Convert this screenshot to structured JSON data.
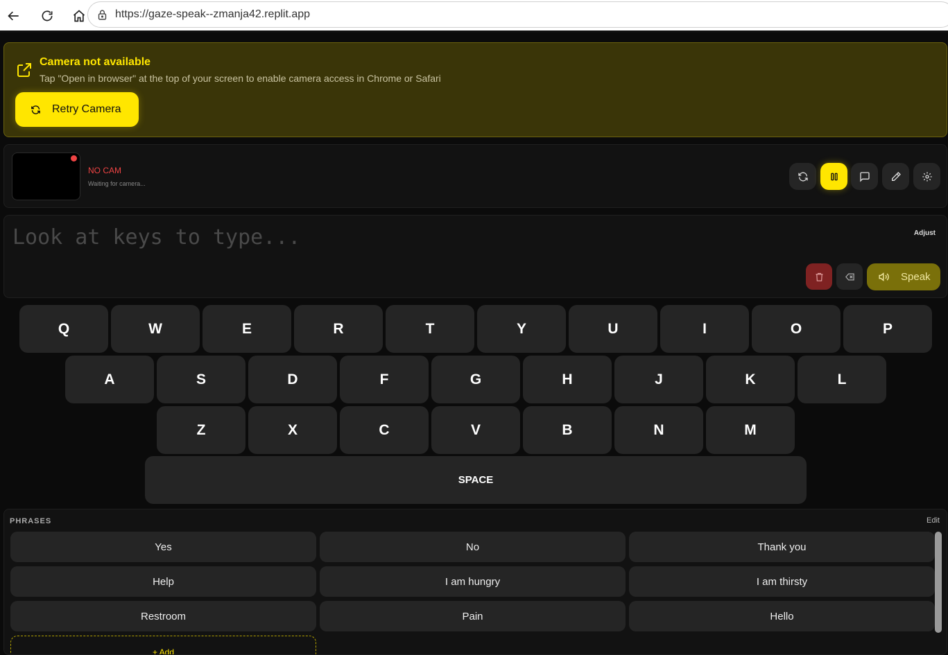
{
  "browser": {
    "url": "https://gaze-speak--zmanja42.replit.app"
  },
  "alert": {
    "title": "Camera not available",
    "message": "Tap \"Open in browser\" at the top of your screen to enable camera access in Chrome or Safari",
    "retry_label": "Retry Camera"
  },
  "camera": {
    "status": "NO CAM",
    "substatus": "Waiting for camera..."
  },
  "composer": {
    "placeholder": "Look at keys to type...",
    "adjust_label": "Adjust",
    "speak_label": "Speak"
  },
  "keyboard": {
    "row1": [
      "Q",
      "W",
      "E",
      "R",
      "T",
      "Y",
      "U",
      "I",
      "O",
      "P"
    ],
    "row2": [
      "A",
      "S",
      "D",
      "F",
      "G",
      "H",
      "J",
      "K",
      "L"
    ],
    "row3": [
      "Z",
      "X",
      "C",
      "V",
      "B",
      "N",
      "M"
    ],
    "space_label": "SPACE"
  },
  "phrases": {
    "title": "PHRASES",
    "edit_label": "Edit",
    "items": [
      "Yes",
      "No",
      "Thank you",
      "Help",
      "I am hungry",
      "I am thirsty",
      "Restroom",
      "Pain",
      "Hello"
    ],
    "add_label": "+ Add"
  },
  "colors": {
    "accent": "#ffe600",
    "danger": "#ef4444",
    "background": "#0b0b0b",
    "key": "#252525"
  }
}
